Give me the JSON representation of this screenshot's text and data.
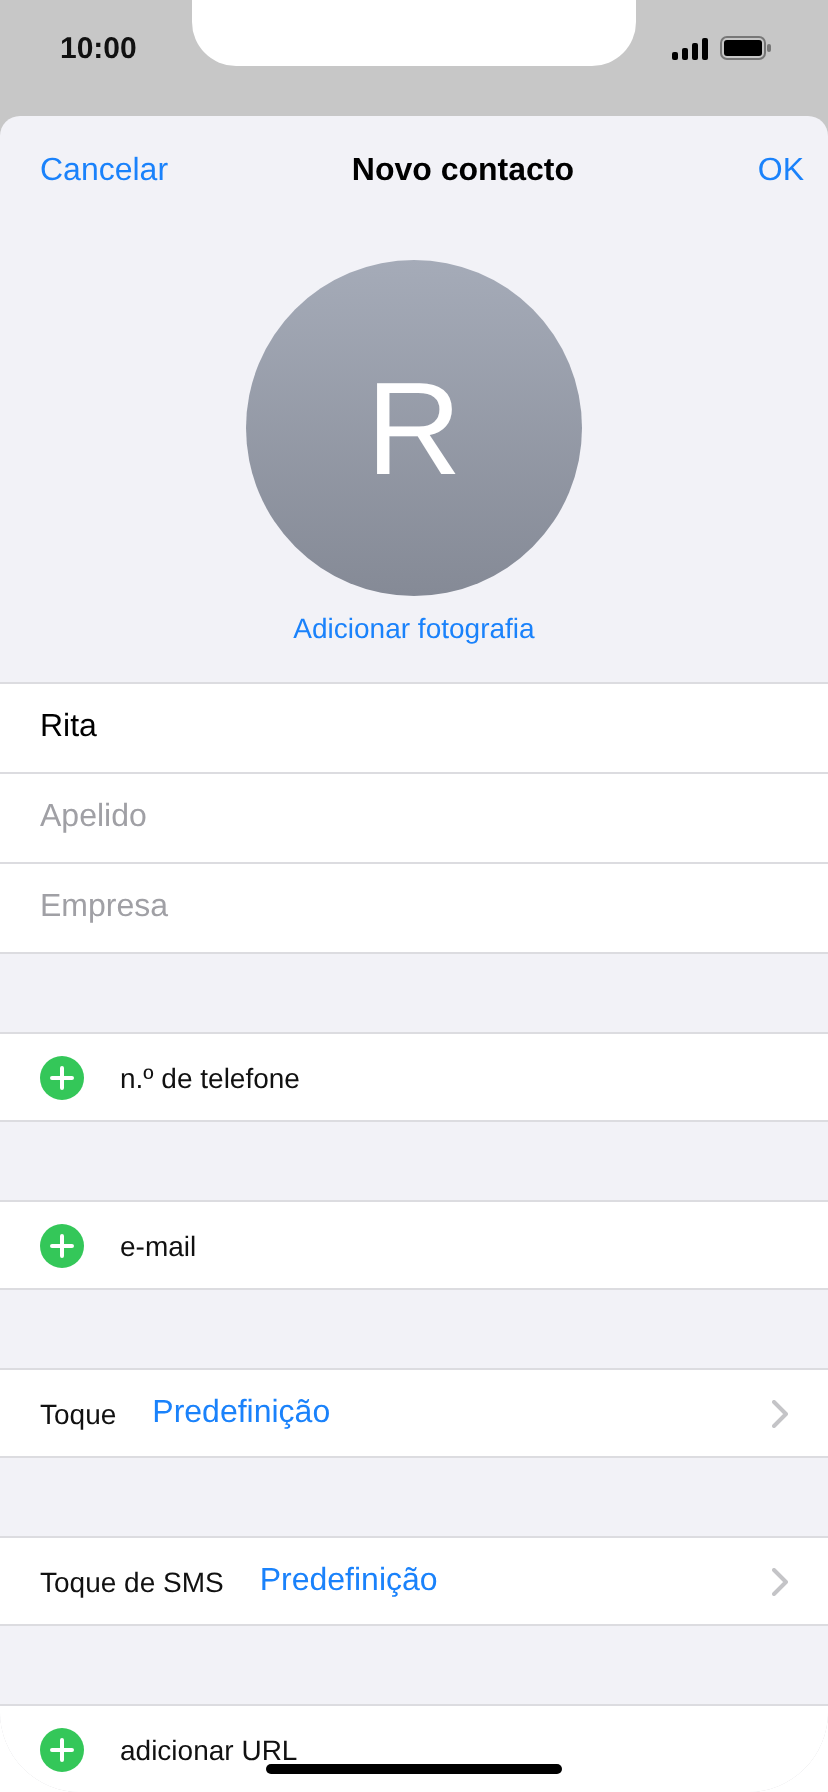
{
  "status_bar": {
    "time": "10:00"
  },
  "nav": {
    "cancel": "Cancelar",
    "title": "Novo contacto",
    "done": "OK"
  },
  "avatar": {
    "initial": "R",
    "action": "Adicionar fotografia"
  },
  "name_fields": [
    {
      "value": "Rita"
    },
    {
      "placeholder": "Apelido"
    },
    {
      "placeholder": "Empresa"
    }
  ],
  "sections": [
    {
      "kind": "add",
      "label": "n.º de telefone"
    },
    {
      "kind": "add",
      "label": "e-mail"
    },
    {
      "kind": "picker",
      "label": "Toque",
      "value": "Predefinição"
    },
    {
      "kind": "picker",
      "label": "Toque de SMS",
      "value": "Predefinição"
    },
    {
      "kind": "add",
      "label": "adicionar URL"
    }
  ]
}
